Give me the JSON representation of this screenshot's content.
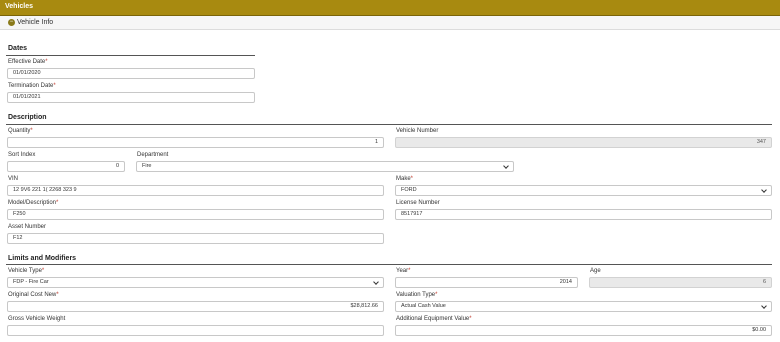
{
  "window": {
    "title": "Vehicles"
  },
  "panel": {
    "toggle_icon": "minus-circle-icon",
    "title": "Vehicle Info"
  },
  "dates": {
    "heading": "Dates",
    "effective_label": "Effective Date",
    "effective_value": "01/01/2020",
    "termination_label": "Termination Date",
    "termination_value": "01/01/2021"
  },
  "description": {
    "heading": "Description",
    "quantity_label": "Quantity",
    "quantity_value": "1",
    "vehicle_number_label": "Vehicle Number",
    "vehicle_number_value": "347",
    "sort_index_label": "Sort Index",
    "sort_index_value": "0",
    "department_label": "Department",
    "department_value": "Fire",
    "vin_label": "VIN",
    "vin_value": "12 9V6 221 1( 2268 323 9",
    "make_label": "Make",
    "make_value": "FORD",
    "model_label": "Model/Description",
    "model_value": "F250",
    "license_label": "License Number",
    "license_value": "8517917",
    "asset_label": "Asset Number",
    "asset_value": "F12"
  },
  "limits": {
    "heading": "Limits and Modifiers",
    "vehicle_type_label": "Vehicle Type",
    "vehicle_type_value": "FDP - Fire Car",
    "year_label": "Year",
    "year_value": "2014",
    "age_label": "Age",
    "age_value": "6",
    "original_cost_label": "Original Cost New",
    "original_cost_value": "$28,812.66",
    "valuation_type_label": "Valuation Type",
    "valuation_type_value": "Actual Cash Value",
    "gross_weight_label": "Gross Vehicle Weight",
    "gross_weight_value": "",
    "additional_equipment_label": "Additional Equipment Value",
    "additional_equipment_value": "$0.00"
  },
  "required_marker": "*"
}
